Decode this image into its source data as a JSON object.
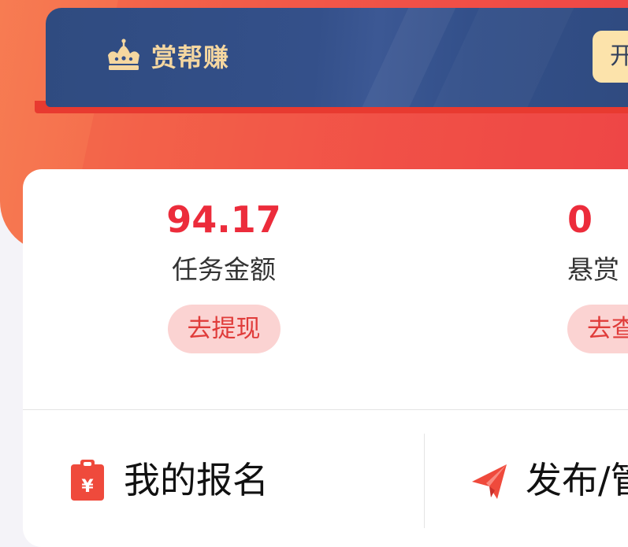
{
  "banner": {
    "brand": "赏帮赚",
    "open_button_label": "开",
    "crown_icon": "crown-icon"
  },
  "stats": [
    {
      "value": "94.17",
      "label": "任务金额",
      "button": "去提现"
    },
    {
      "value": "0",
      "label": "悬赏",
      "button": "去查"
    }
  ],
  "actions": [
    {
      "label": "我的报名",
      "icon": "clipboard-yen-icon"
    },
    {
      "label": "发布/管",
      "icon": "paper-plane-icon"
    }
  ],
  "colors": {
    "accent_red": "#ec2c3b",
    "banner_blue": "#2f4b80",
    "gold": "#f5d7a0",
    "pill_bg": "#fbd3d2"
  }
}
